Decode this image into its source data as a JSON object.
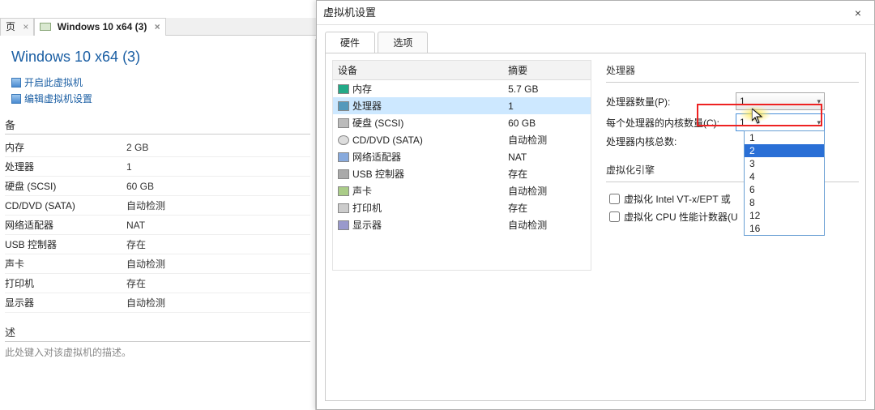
{
  "tab_strip": {
    "page_tab": "页",
    "vm_tab": "Windows 10 x64 (3)",
    "close_glyph": "×"
  },
  "vm_summary": {
    "title": "Windows 10 x64 (3)",
    "links": {
      "power_on": "开启此虚拟机",
      "edit": "编辑虚拟机设置"
    },
    "device_header": "备",
    "specs": [
      {
        "k": "内存",
        "v": "2 GB"
      },
      {
        "k": "处理器",
        "v": "1"
      },
      {
        "k": "硬盘 (SCSI)",
        "v": "60 GB"
      },
      {
        "k": "CD/DVD (SATA)",
        "v": "自动检测"
      },
      {
        "k": "网络适配器",
        "v": "NAT"
      },
      {
        "k": "USB 控制器",
        "v": "存在"
      },
      {
        "k": "声卡",
        "v": "自动检测"
      },
      {
        "k": "打印机",
        "v": "存在"
      },
      {
        "k": "显示器",
        "v": "自动检测"
      }
    ],
    "desc_header": "述",
    "desc_hint": "此处键入对该虚拟机的描述。"
  },
  "dialog": {
    "title": "虚拟机设置",
    "close_glyph": "×",
    "tabs": {
      "hardware": "硬件",
      "options": "选项"
    },
    "hw_table": {
      "cols": {
        "device": "设备",
        "summary": "摘要"
      },
      "rows": [
        {
          "icon": "mem",
          "name": "内存",
          "summary": "5.7 GB"
        },
        {
          "icon": "cpu",
          "name": "处理器",
          "summary": "1"
        },
        {
          "icon": "disk",
          "name": "硬盘 (SCSI)",
          "summary": "60 GB"
        },
        {
          "icon": "cd",
          "name": "CD/DVD (SATA)",
          "summary": "自动检测"
        },
        {
          "icon": "net",
          "name": "网络适配器",
          "summary": "NAT"
        },
        {
          "icon": "usb",
          "name": "USB 控制器",
          "summary": "存在"
        },
        {
          "icon": "snd",
          "name": "声卡",
          "summary": "自动检测"
        },
        {
          "icon": "prn",
          "name": "打印机",
          "summary": "存在"
        },
        {
          "icon": "disp",
          "name": "显示器",
          "summary": "自动检测"
        }
      ],
      "selected_index": 1
    },
    "cpu_group": {
      "title": "处理器",
      "num_proc_label": "处理器数量(P):",
      "num_proc_value": "1",
      "cores_label": "每个处理器的内核数量(C):",
      "cores_value": "1",
      "total_label": "处理器内核总数:",
      "total_value": "",
      "dropdown_options": [
        "1",
        "2",
        "3",
        "4",
        "6",
        "8",
        "12",
        "16"
      ],
      "dropdown_highlight_index": 1
    },
    "virt_group": {
      "title": "虚拟化引擎",
      "vt_label": "虚拟化 Intel VT-x/EPT 或",
      "perf_label": "虚拟化 CPU 性能计数器(U"
    }
  }
}
